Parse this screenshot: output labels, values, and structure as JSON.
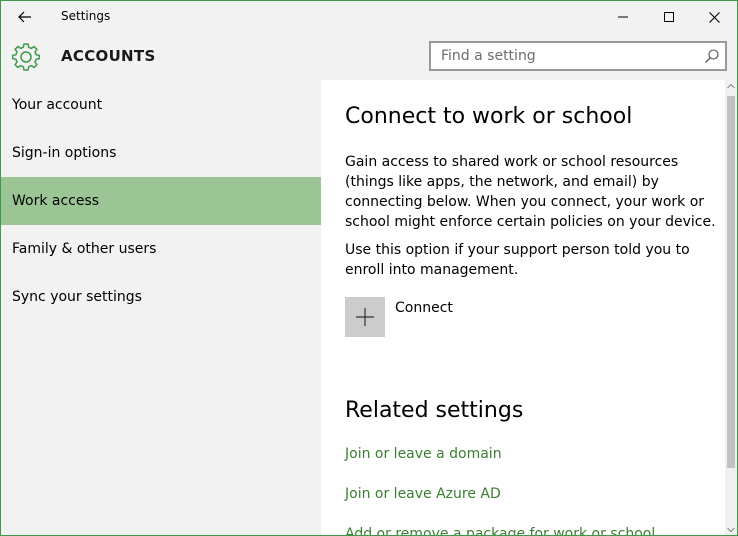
{
  "window": {
    "title": "Settings"
  },
  "header": {
    "section_title": "ACCOUNTS",
    "search": {
      "value": "",
      "placeholder": "Find a setting"
    }
  },
  "sidebar": {
    "items": [
      {
        "label": "Your account",
        "active": false
      },
      {
        "label": "Sign-in options",
        "active": false
      },
      {
        "label": "Work access",
        "active": true
      },
      {
        "label": "Family & other users",
        "active": false
      },
      {
        "label": "Sync your settings",
        "active": false
      }
    ]
  },
  "main": {
    "title": "Connect to work or school",
    "description_1": "Gain access to shared work or school resources (things like apps, the network, and email) by connecting below. When you connect, your work or school might enforce certain policies on your device.",
    "description_2": "Use this option if your support person told you to enroll into management.",
    "connect_label": "Connect",
    "related_title": "Related settings",
    "related_links": [
      "Join or leave a domain",
      "Join or leave Azure AD",
      "Add or remove a package for work or school"
    ]
  },
  "colors": {
    "accent": "#3c9a48",
    "active_nav": "#9bc595",
    "link": "#3a7f32",
    "chrome": "#f2f2f2"
  },
  "icons": {
    "back": "back-arrow-icon",
    "settings": "gear-icon",
    "search": "search-icon",
    "minimize": "minimize-icon",
    "maximize": "maximize-icon",
    "close": "close-icon",
    "connect": "plus-icon"
  }
}
